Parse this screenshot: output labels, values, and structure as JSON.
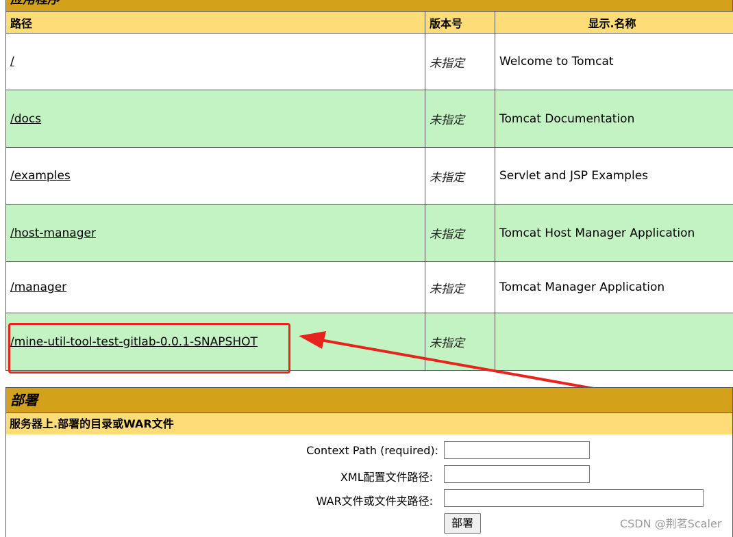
{
  "apps_section": {
    "title": "应用程序",
    "headers": {
      "path": "路径",
      "version": "版本号",
      "display_name": "显示.名称"
    },
    "rows": [
      {
        "path": "/",
        "version": "未指定",
        "display_name": "Welcome to Tomcat"
      },
      {
        "path": "/docs",
        "version": "未指定",
        "display_name": "Tomcat Documentation"
      },
      {
        "path": "/examples",
        "version": "未指定",
        "display_name": "Servlet and JSP Examples"
      },
      {
        "path": "/host-manager",
        "version": "未指定",
        "display_name": "Tomcat Host Manager Application"
      },
      {
        "path": "/manager",
        "version": "未指定",
        "display_name": "Tomcat Manager Application"
      },
      {
        "path": "/mine-util-tool-test-gitlab-0.0.1-SNAPSHOT",
        "version": "未指定",
        "display_name": ""
      }
    ]
  },
  "deploy_section": {
    "title": "部署",
    "subtitle": "服务器上.部署的目录或WAR文件",
    "fields": {
      "context_path_label": "Context Path (required):",
      "context_path_value": "",
      "xml_config_label": "XML配置文件路径:",
      "xml_config_value": "",
      "war_path_label": "WAR文件或文件夹路径:",
      "war_path_value": ""
    },
    "deploy_button": "部署"
  },
  "annotation": {
    "color": "#e8231d"
  },
  "watermark": "CSDN @荆茗Scaler"
}
